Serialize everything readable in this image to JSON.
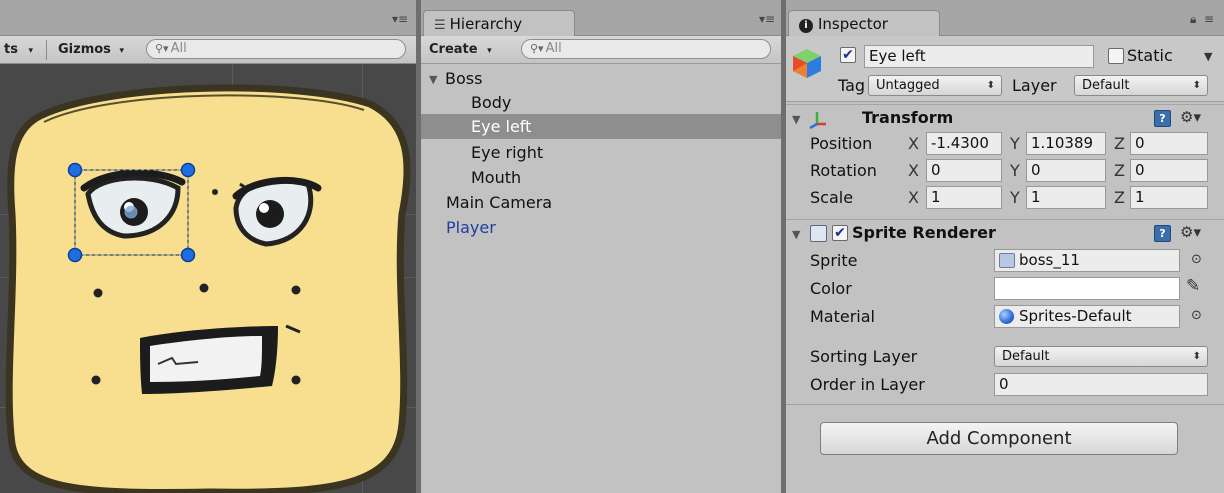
{
  "scene": {
    "toolbar": {
      "effects_label": "ts",
      "gizmos_label": "Gizmos",
      "search_placeholder": "All"
    }
  },
  "hierarchy": {
    "tab_label": "Hierarchy",
    "create_label": "Create",
    "search_placeholder": "All",
    "items": [
      {
        "label": "Boss"
      },
      {
        "label": "Body"
      },
      {
        "label": "Eye left"
      },
      {
        "label": "Eye right"
      },
      {
        "label": "Mouth"
      },
      {
        "label": "Main Camera"
      },
      {
        "label": "Player"
      }
    ]
  },
  "inspector": {
    "tab_label": "Inspector",
    "object_name": "Eye left",
    "static_label": "Static",
    "tag_label": "Tag",
    "tag_value": "Untagged",
    "layer_label": "Layer",
    "layer_value": "Default",
    "transform": {
      "title": "Transform",
      "position_label": "Position",
      "rotation_label": "Rotation",
      "scale_label": "Scale",
      "position": {
        "x": "-1.4300",
        "y": "1.10389",
        "z": "0"
      },
      "rotation": {
        "x": "0",
        "y": "0",
        "z": "0"
      },
      "scale": {
        "x": "1",
        "y": "1",
        "z": "1"
      }
    },
    "axis_labels": {
      "x": "X",
      "y": "Y",
      "z": "Z"
    },
    "sprite_renderer": {
      "title": "Sprite Renderer",
      "sprite_label": "Sprite",
      "sprite_value": "boss_11",
      "color_label": "Color",
      "material_label": "Material",
      "material_value": "Sprites-Default",
      "sorting_layer_label": "Sorting Layer",
      "sorting_layer_value": "Default",
      "order_label": "Order in Layer",
      "order_value": "0"
    },
    "add_component_label": "Add Component"
  },
  "colors": {
    "panel_bg": "#c2c2c2",
    "selection_bg": "#8e8e8e",
    "scene_bg": "#484848",
    "boss_fill": "#f7df8f",
    "handle_blue": "#1e6ee0",
    "player_text": "#1f3fa0"
  }
}
